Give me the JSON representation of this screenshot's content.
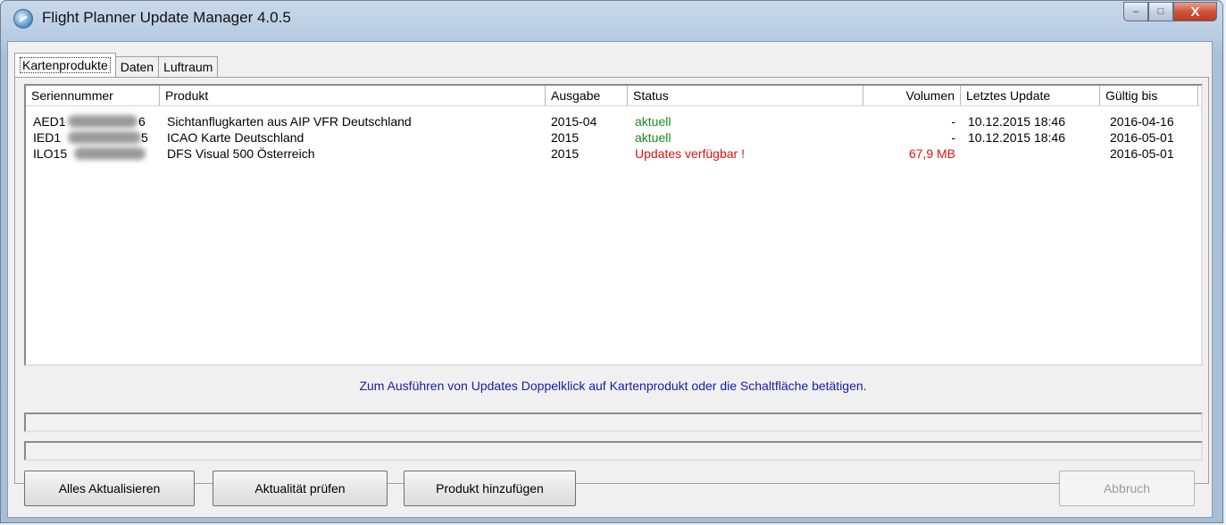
{
  "window": {
    "title": "Flight Planner Update Manager 4.0.5",
    "controls": {
      "minimize": "–",
      "maximize": "□",
      "close": "X"
    }
  },
  "tabs": [
    {
      "label": "Kartenprodukte",
      "active": true
    },
    {
      "label": "Daten",
      "active": false
    },
    {
      "label": "Luftraum",
      "active": false
    }
  ],
  "table": {
    "columns": [
      "Seriennummer",
      "Produkt",
      "Ausgabe",
      "Status",
      "Volumen",
      "Letztes Update",
      "Gültig bis"
    ],
    "rows": [
      {
        "serial": "AED1",
        "serial_end": "6",
        "product": "Sichtanflugkarten aus AIP VFR Deutschland",
        "edition": "2015-04",
        "status": "aktuell",
        "status_type": "ok",
        "volume": "-",
        "last_update": "10.12.2015 18:46",
        "valid_until": "2016-04-16"
      },
      {
        "serial": "IED1",
        "serial_end": "5",
        "product": "ICAO Karte Deutschland",
        "edition": "2015",
        "status": "aktuell",
        "status_type": "ok",
        "volume": "-",
        "last_update": "10.12.2015 18:46",
        "valid_until": "2016-05-01"
      },
      {
        "serial": "ILO15",
        "serial_end": "",
        "product": "DFS Visual 500 Österreich",
        "edition": "2015",
        "status": "Updates verfügbar !",
        "status_type": "update",
        "volume": "67,9 MB",
        "last_update": "",
        "valid_until": "2016-05-01"
      }
    ]
  },
  "hint": "Zum Ausführen von Updates Doppelklick auf Kartenprodukt oder die Schaltfläche betätigen.",
  "buttons": {
    "update_all": "Alles Aktualisieren",
    "check": "Aktualität prüfen",
    "add_product": "Produkt hinzufügen",
    "abort": "Abbruch"
  },
  "colors": {
    "ok": "#1a8a1a",
    "update": "#e01010",
    "hint": "#1a1aa8"
  }
}
